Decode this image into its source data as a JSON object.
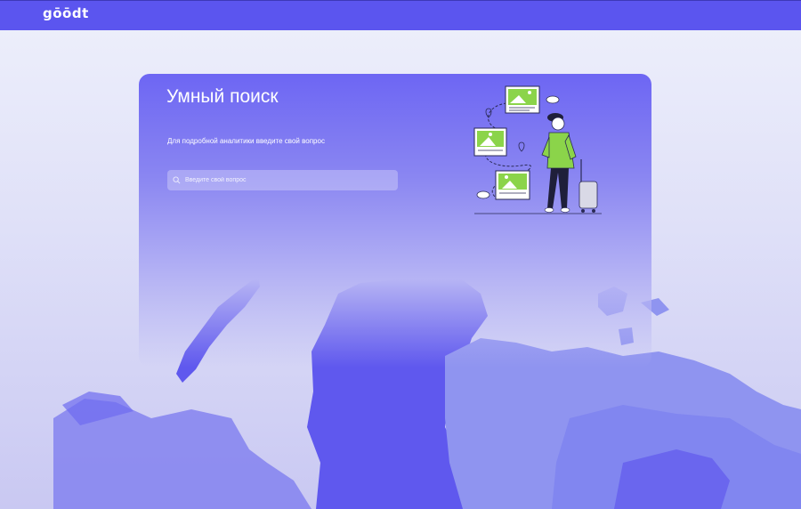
{
  "header": {
    "logo_text": "gōōdt",
    "background_color": "#5b55ef"
  },
  "search_card": {
    "title": "Умный поиск",
    "subtitle": "Для подробной аналитики введите свой вопрос",
    "search": {
      "placeholder": "Введите свой вопрос",
      "value": ""
    }
  },
  "colors": {
    "accent": "#5b55ef",
    "map_dark": "#5f58ee",
    "map_light": "#8f94f0",
    "illustration_green": "#8bd44a"
  },
  "icons": [
    "search-icon",
    "map-pin-icon",
    "traveler-illustration",
    "suitcase-icon",
    "photo-card-icon"
  ]
}
